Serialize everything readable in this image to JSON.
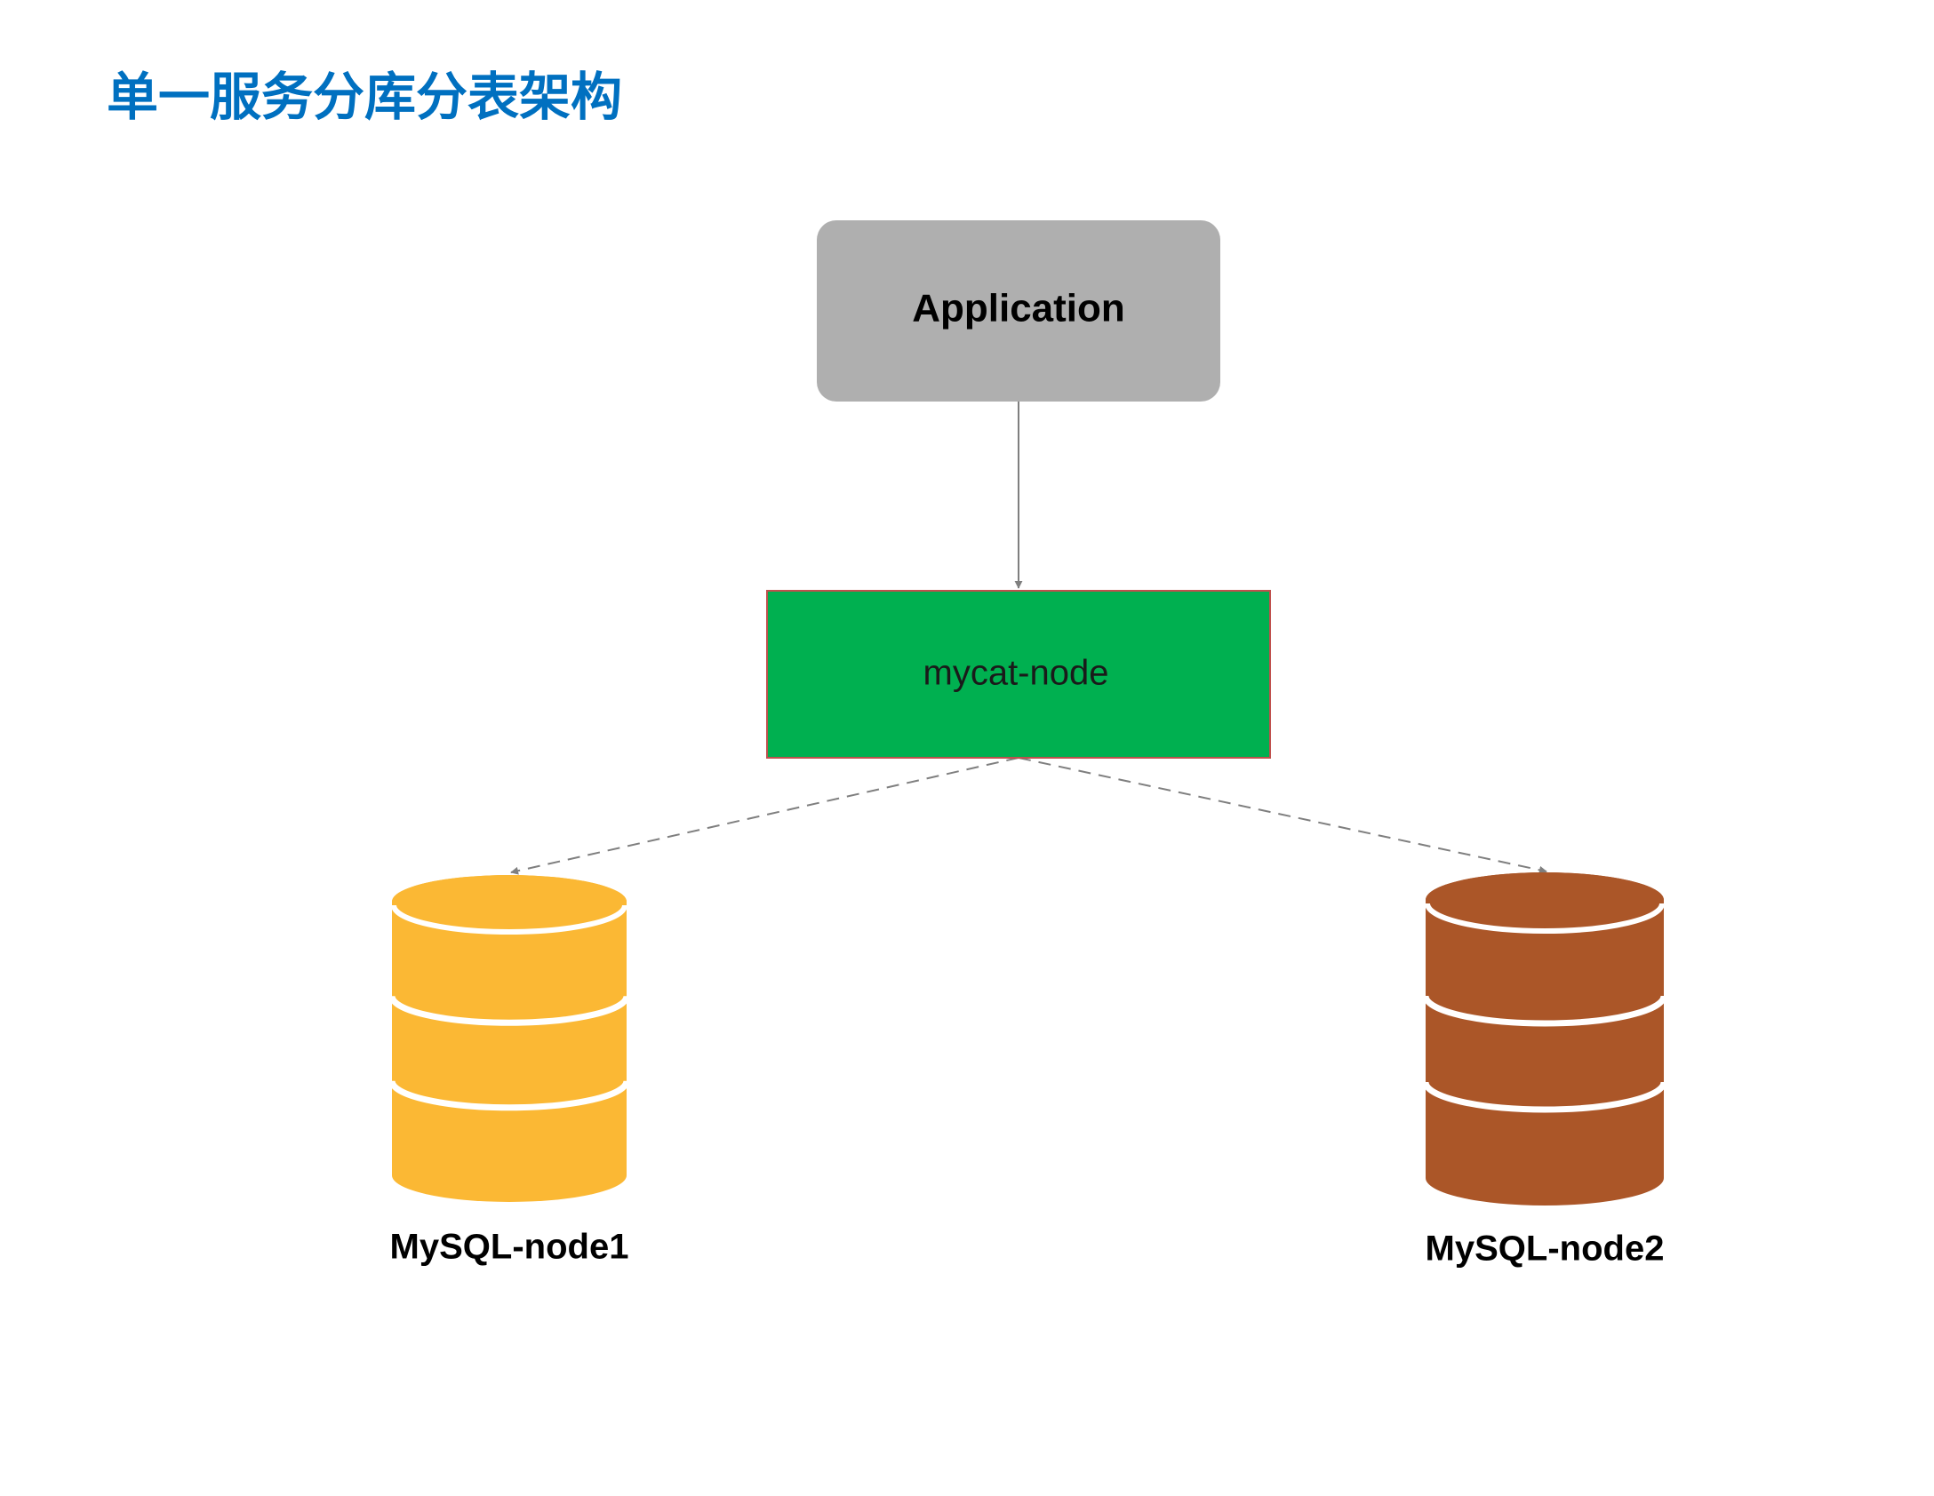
{
  "title": "单一服务分库分表架构",
  "colors": {
    "title": "#0070c0",
    "application_fill": "#afafaf",
    "mycat_fill": "#00b050",
    "mycat_border": "#c0504d",
    "node1_fill": "#fbb834",
    "node2_fill": "#ab5628",
    "connector": "#7f7f7f"
  },
  "nodes": {
    "application": {
      "label": "Application",
      "icon": "rounded-rectangle"
    },
    "mycat": {
      "label": "mycat-node",
      "icon": "rectangle"
    },
    "mysql1": {
      "label": "MySQL-node1",
      "icon": "database-cylinder-icon"
    },
    "mysql2": {
      "label": "MySQL-node2",
      "icon": "database-cylinder-icon"
    }
  },
  "edges": [
    {
      "from": "application",
      "to": "mycat",
      "style": "solid",
      "arrow": "end"
    },
    {
      "from": "mycat",
      "to": "mysql1",
      "style": "dashed",
      "arrow": "end"
    },
    {
      "from": "mycat",
      "to": "mysql2",
      "style": "dashed",
      "arrow": "end"
    }
  ]
}
